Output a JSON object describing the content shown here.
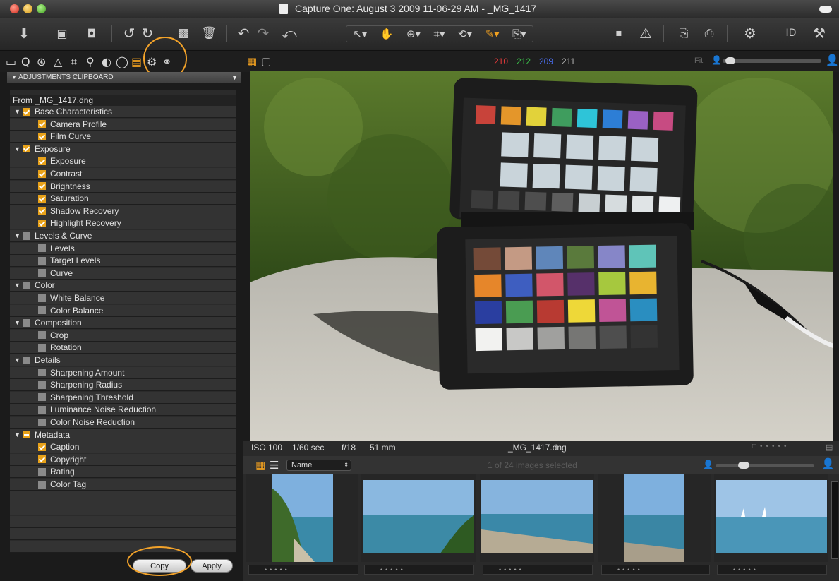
{
  "window": {
    "title": "Capture One: August 3 2009 11-06-29 AM - _MG_1417"
  },
  "panel": {
    "header": "ADJUSTMENTS CLIPBOARD",
    "from_label": "From _MG_1417.dng",
    "items": [
      {
        "label": "Base Characteristics",
        "level": 0,
        "state": "on"
      },
      {
        "label": "Camera Profile",
        "level": 1,
        "state": "on"
      },
      {
        "label": "Film Curve",
        "level": 1,
        "state": "on"
      },
      {
        "label": "Exposure",
        "level": 0,
        "state": "on"
      },
      {
        "label": "Exposure",
        "level": 1,
        "state": "on"
      },
      {
        "label": "Contrast",
        "level": 1,
        "state": "on"
      },
      {
        "label": "Brightness",
        "level": 1,
        "state": "on"
      },
      {
        "label": "Saturation",
        "level": 1,
        "state": "on"
      },
      {
        "label": "Shadow Recovery",
        "level": 1,
        "state": "on"
      },
      {
        "label": "Highlight Recovery",
        "level": 1,
        "state": "on"
      },
      {
        "label": "Levels & Curve",
        "level": 0,
        "state": "off"
      },
      {
        "label": "Levels",
        "level": 1,
        "state": "off"
      },
      {
        "label": "Target Levels",
        "level": 1,
        "state": "off"
      },
      {
        "label": "Curve",
        "level": 1,
        "state": "off"
      },
      {
        "label": "Color",
        "level": 0,
        "state": "off"
      },
      {
        "label": "White Balance",
        "level": 1,
        "state": "off"
      },
      {
        "label": "Color Balance",
        "level": 1,
        "state": "off"
      },
      {
        "label": "Composition",
        "level": 0,
        "state": "off"
      },
      {
        "label": "Crop",
        "level": 1,
        "state": "off"
      },
      {
        "label": "Rotation",
        "level": 1,
        "state": "off"
      },
      {
        "label": "Details",
        "level": 0,
        "state": "off"
      },
      {
        "label": "Sharpening Amount",
        "level": 1,
        "state": "off"
      },
      {
        "label": "Sharpening Radius",
        "level": 1,
        "state": "off"
      },
      {
        "label": "Sharpening Threshold",
        "level": 1,
        "state": "off"
      },
      {
        "label": "Luminance Noise Reduction",
        "level": 1,
        "state": "off"
      },
      {
        "label": "Color Noise Reduction",
        "level": 1,
        "state": "off"
      },
      {
        "label": "Metadata",
        "level": 0,
        "state": "mixed"
      },
      {
        "label": "Caption",
        "level": 1,
        "state": "on"
      },
      {
        "label": "Copyright",
        "level": 1,
        "state": "on"
      },
      {
        "label": "Rating",
        "level": 1,
        "state": "off"
      },
      {
        "label": "Color Tag",
        "level": 1,
        "state": "off"
      }
    ],
    "copy_label": "Copy",
    "apply_label": "Apply"
  },
  "viewer": {
    "rgb": {
      "r": "210",
      "g": "212",
      "b": "209",
      "a": "211"
    },
    "fit_label": "Fit",
    "info": {
      "iso": "ISO 100",
      "shutter": "1/60 sec",
      "aperture": "f/18",
      "focal": "51 mm",
      "filename": "_MG_1417.dng"
    }
  },
  "browser": {
    "sort_label": "Name",
    "selection_text": "1 of 24 images selected"
  },
  "colors": {
    "accent": "#f0a020",
    "highlight_circle": "#f3a32a"
  }
}
